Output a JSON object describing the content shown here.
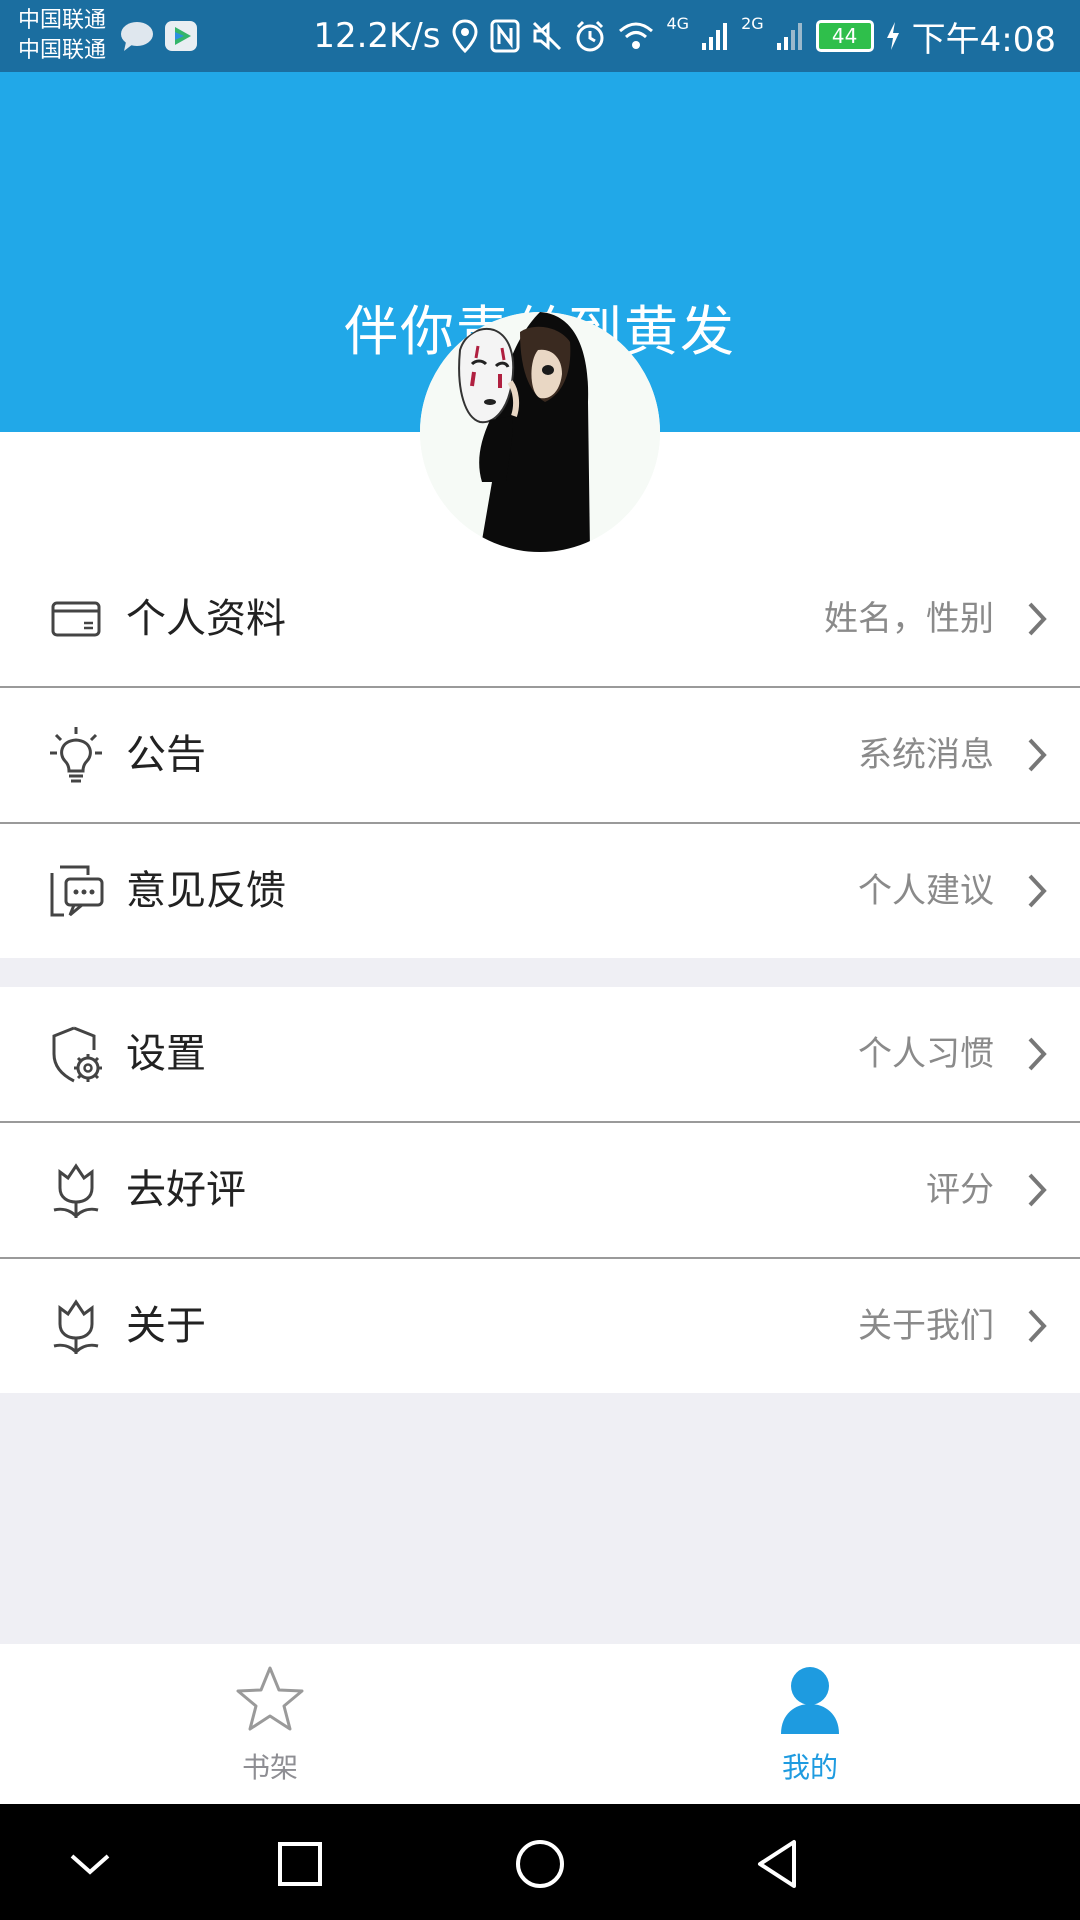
{
  "status_bar": {
    "carrier_1": "中国联通",
    "carrier_2": "中国联通",
    "net_speed": "12.2K/s",
    "net_4g": "4G",
    "net_2g": "2G",
    "battery": "44",
    "time": "下午4:08"
  },
  "header": {
    "title": "伴你青丝到黄发"
  },
  "menu_group_1": [
    {
      "label": "个人资料",
      "detail": "姓名，性别",
      "icon": "id-card-icon"
    },
    {
      "label": "公告",
      "detail": "系统消息",
      "icon": "lightbulb-icon"
    },
    {
      "label": "意见反馈",
      "detail": "个人建议",
      "icon": "feedback-icon"
    }
  ],
  "menu_group_2": [
    {
      "label": "设置",
      "detail": "个人习惯",
      "icon": "shield-gear-icon"
    },
    {
      "label": "去好评",
      "detail": "评分",
      "icon": "tulip-icon"
    },
    {
      "label": "关于",
      "detail": "关于我们",
      "icon": "tulip-icon"
    }
  ],
  "tab_bar": {
    "tabs": [
      {
        "label": "书架",
        "icon": "star-icon",
        "active": false
      },
      {
        "label": "我的",
        "icon": "person-icon",
        "active": true
      }
    ]
  },
  "colors": {
    "header_blue": "#21a8e8",
    "active_tab": "#1e9be0",
    "inactive_tab": "#8e8e93"
  }
}
